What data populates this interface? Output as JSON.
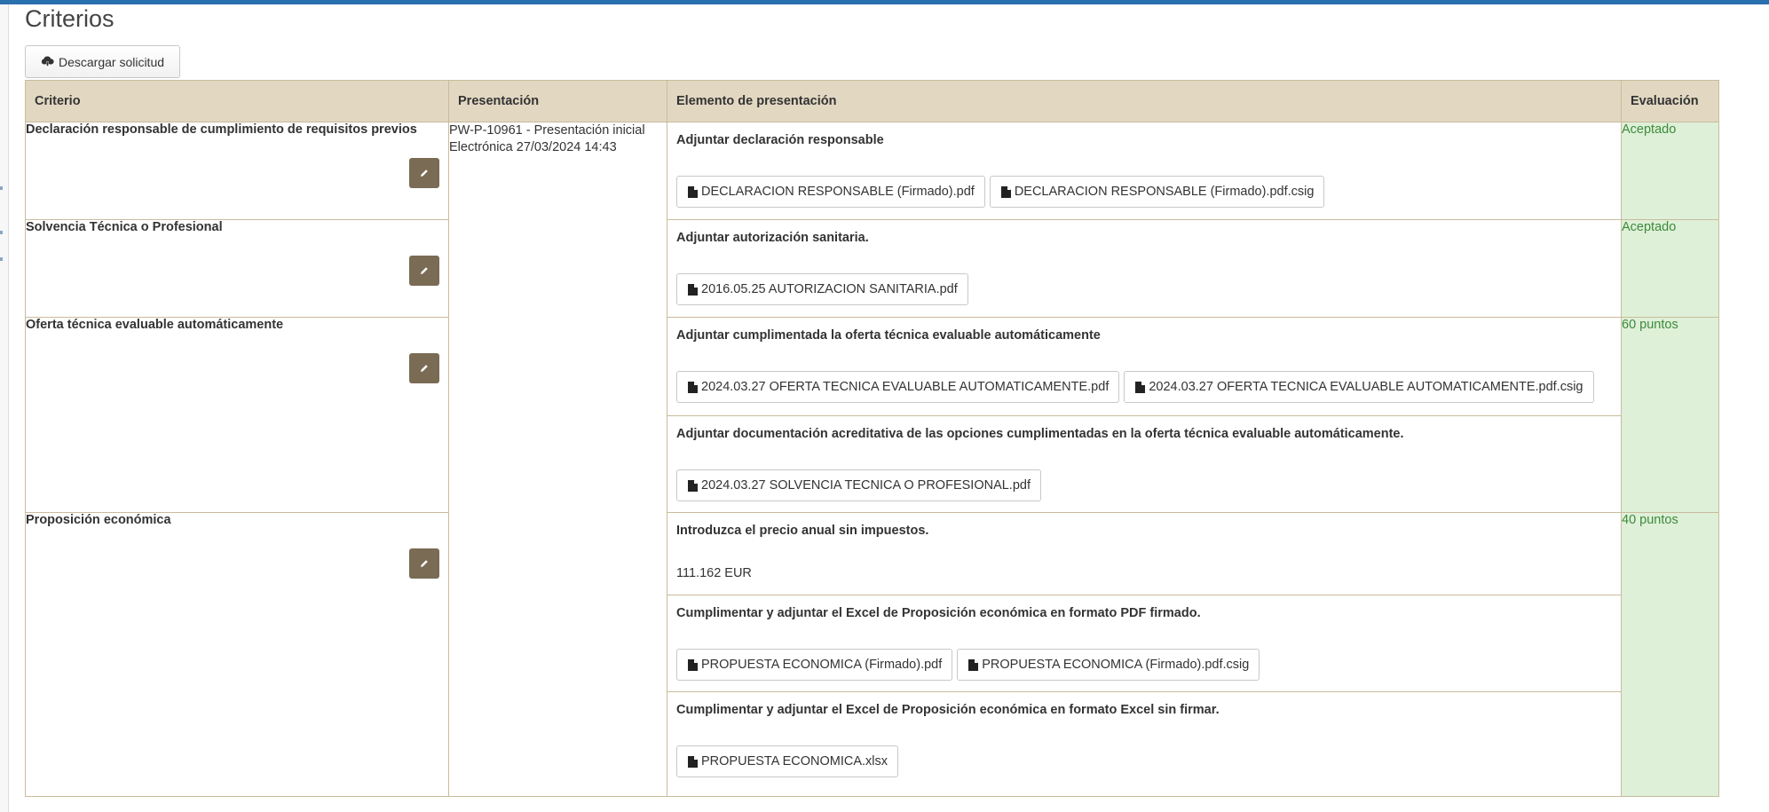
{
  "page": {
    "title": "Criterios",
    "download_button": "Descargar solicitud",
    "download_icon": "cloud-download-icon"
  },
  "table": {
    "headers": {
      "criterio": "Criterio",
      "presentacion": "Presentación",
      "elemento": "Elemento de presentación",
      "evaluacion": "Evaluación"
    },
    "presentation": {
      "line1": "PW-P-10961 - Presentación inicial",
      "line2": "Electrónica 27/03/2024 14:43"
    },
    "rows": [
      {
        "criterio": "Declaración responsable de cumplimiento de requisitos previos",
        "evaluacion": "Aceptado",
        "elements": [
          {
            "title": "Adjuntar declaración responsable",
            "files": [
              "DECLARACION RESPONSABLE (Firmado).pdf",
              "DECLARACION RESPONSABLE (Firmado).pdf.csig"
            ]
          }
        ]
      },
      {
        "criterio": "Solvencia Técnica o Profesional",
        "evaluacion": "Aceptado",
        "elements": [
          {
            "title": "Adjuntar autorización sanitaria.",
            "files": [
              "2016.05.25 AUTORIZACION SANITARIA.pdf"
            ]
          }
        ]
      },
      {
        "criterio": "Oferta técnica evaluable automáticamente",
        "evaluacion": "60 puntos",
        "elements": [
          {
            "title": "Adjuntar cumplimentada la oferta técnica evaluable automáticamente",
            "files": [
              "2024.03.27 OFERTA TECNICA EVALUABLE AUTOMATICAMENTE.pdf",
              "2024.03.27 OFERTA TECNICA EVALUABLE AUTOMATICAMENTE.pdf.csig"
            ]
          },
          {
            "title": "Adjuntar documentación acreditativa de las opciones cumplimentadas en la oferta técnica evaluable automáticamente.",
            "files": [
              "2024.03.27 SOLVENCIA TECNICA O PROFESIONAL.pdf"
            ]
          }
        ]
      },
      {
        "criterio": "Proposición económica",
        "evaluacion": "40 puntos",
        "elements": [
          {
            "title": "Introduzca el precio anual sin impuestos.",
            "value": "111.162 EUR"
          },
          {
            "title": "Cumplimentar y adjuntar el Excel de Proposición económica en formato PDF firmado.",
            "files": [
              "PROPUESTA ECONOMICA (Firmado).pdf",
              "PROPUESTA ECONOMICA (Firmado).pdf.csig"
            ]
          },
          {
            "title": "Cumplimentar y adjuntar el Excel de Proposición económica en formato Excel sin firmar.",
            "files": [
              "PROPUESTA ECONOMICA.xlsx"
            ]
          }
        ]
      }
    ]
  },
  "icons": {
    "edit": "pencil-icon",
    "file": "file-icon"
  },
  "colors": {
    "header_bg": "#e2d8c2",
    "eval_bg": "#dff0d8",
    "eval_text": "#3c8a3c",
    "edit_btn": "#7a6b55",
    "top_line": "#2a6fae"
  }
}
